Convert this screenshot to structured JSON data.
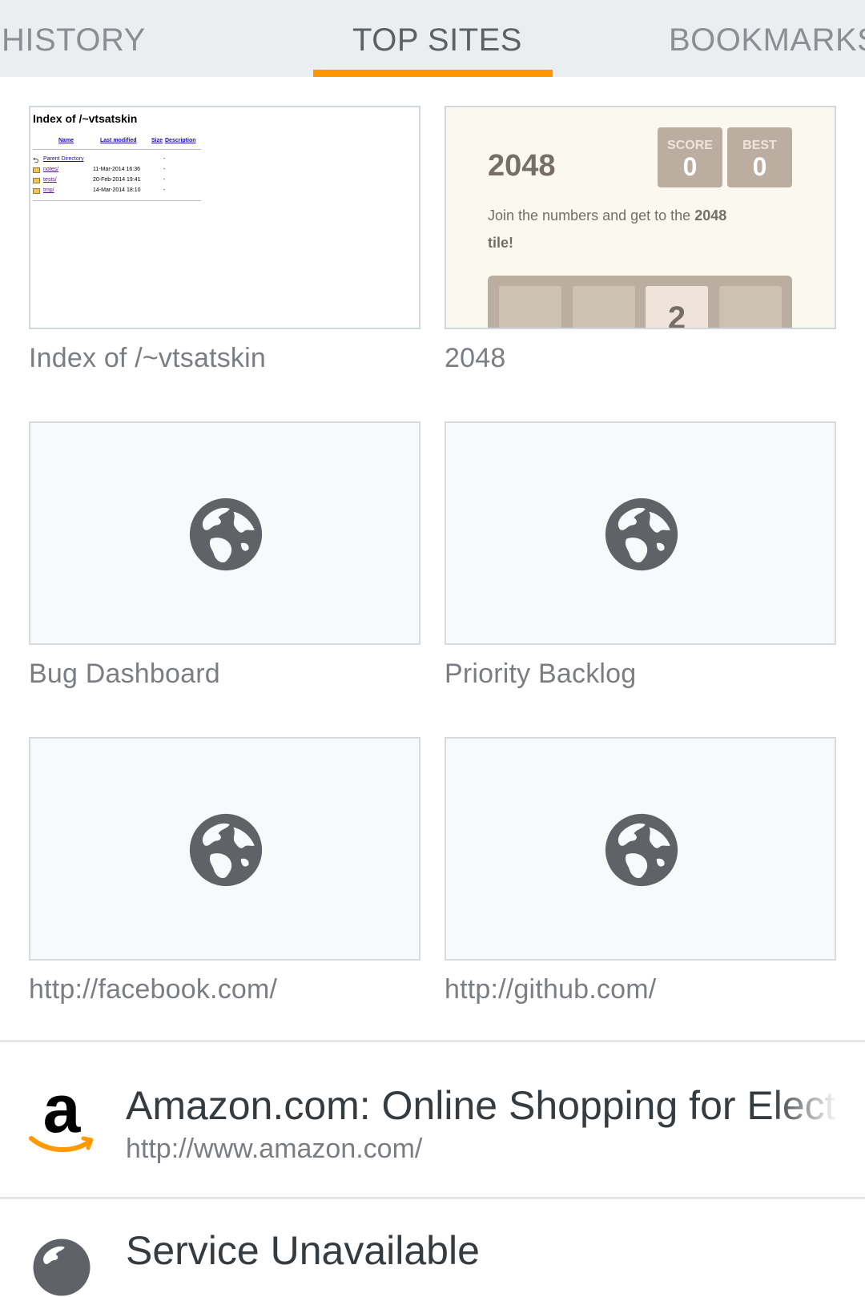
{
  "tabs": [
    {
      "label": "HISTORY",
      "active": false
    },
    {
      "label": "TOP SITES",
      "active": true
    },
    {
      "label": "BOOKMARKS",
      "active": false
    }
  ],
  "colors": {
    "accent": "#ff9500",
    "tabbar_bg": "#eaeef1",
    "globe": "#5f6368"
  },
  "index_thumb": {
    "title": "Index of /~vtsatskin",
    "headers": {
      "name": "Name",
      "modified": "Last modified",
      "size": "Size",
      "description": "Description"
    },
    "parent": "Parent Directory",
    "parent_size": "-",
    "rows": [
      {
        "name": "notes/",
        "date": "11-Mar-2014 16:36",
        "size": "-"
      },
      {
        "name": "tests/",
        "date": "20-Feb-2014 19:41",
        "size": "-"
      },
      {
        "name": "tmp/",
        "date": "14-Mar-2014 18:10",
        "size": "-"
      }
    ]
  },
  "game_thumb": {
    "title": "2048",
    "score_label": "SCORE",
    "score": "0",
    "best_label": "BEST",
    "best": "0",
    "desc_prefix": "Join the numbers and get to the",
    "desc_bold": "2048",
    "desc_suffix": "tile!",
    "visible_tile": "2"
  },
  "tiles": [
    {
      "label": "Index of /~vtsatskin",
      "thumb": "index"
    },
    {
      "label": "2048",
      "thumb": "game"
    },
    {
      "label": "Bug Dashboard",
      "icon": "globe-icon"
    },
    {
      "label": "Priority Backlog",
      "icon": "globe-icon"
    },
    {
      "label": "http://facebook.com/",
      "icon": "globe-icon"
    },
    {
      "label": "http://github.com/",
      "icon": "globe-icon"
    }
  ],
  "list": [
    {
      "title": "Amazon.com: Online Shopping for Electronics, Apparel, Computers, Books, DVDs & more",
      "url": "http://www.amazon.com/",
      "icon": "amazon-logo-icon"
    },
    {
      "title": "Service Unavailable",
      "url": "",
      "icon": "globe-icon"
    }
  ]
}
